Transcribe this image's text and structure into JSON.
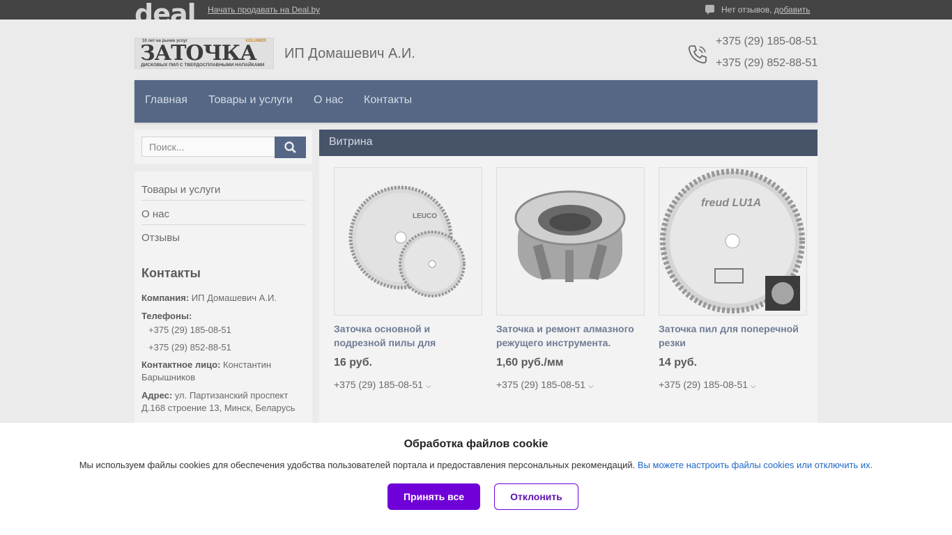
{
  "topbar": {
    "logo_text": "deal",
    "sell_link": "Начать продавать на Deal.by",
    "reviews_text": "Нет отзывов,",
    "reviews_add": "добавить"
  },
  "header": {
    "logo": {
      "top_small": "10 лет на рынке услуг",
      "brand": "VOLUMER",
      "word": "ЗАТОЧКА",
      "sub": "ДИСКОВЫХ ПИЛ С ТВЕРДОСПЛАВНЫМИ НАПАЙКАМИ"
    },
    "company": "ИП Домашевич А.И.",
    "phones": [
      "+375 (29) 185-08-51",
      "+375 (29) 852-88-51"
    ]
  },
  "nav": {
    "items": [
      "Главная",
      "Товары и услуги",
      "О нас",
      "Контакты"
    ]
  },
  "search": {
    "placeholder": "Поиск..."
  },
  "sidebar": {
    "menu": [
      "Товары и услуги",
      "О нас",
      "Отзывы"
    ],
    "contacts_title": "Контакты",
    "company_label": "Компания:",
    "company_value": "ИП Домашевич А.И.",
    "phones_label": "Телефоны:",
    "phones": [
      "+375 (29) 185-08-51",
      "+375 (29) 852-88-51"
    ],
    "person_label": "Контактное лицо:",
    "person_value": "Константин Барышников",
    "address_label": "Адрес:",
    "address_value": "ул. Партизанский проспект Д.168 строение 13, Минск, Беларусь"
  },
  "showcase": {
    "title": "Витрина",
    "products": [
      {
        "title": "Заточка основной и подрезной пилы для",
        "price": "16 руб.",
        "phone": "+375 (29) 185-08-51",
        "image_label": "LEUCO"
      },
      {
        "title": "Заточка и ремонт алмазного режущего инструмента.",
        "price": "1,60 руб./мм",
        "phone": "+375 (29) 185-08-51",
        "image_label": ""
      },
      {
        "title": "Заточка пил для поперечной резки",
        "price": "14 руб.",
        "phone": "+375 (29) 185-08-51",
        "image_label": "freud LU1A"
      }
    ]
  },
  "cookie": {
    "title": "Обработка файлов cookie",
    "text": "Мы используем файлы cookies для обеспечения удобства пользователей портала и предоставления персональных рекомендаций.",
    "link": "Вы можете настроить файлы cookies или отключить их.",
    "accept": "Принять все",
    "decline": "Отклонить"
  },
  "colors": {
    "nav": "#3e5275",
    "showcase_header": "#2d3c55",
    "accept": "#7000d8",
    "link": "#1f66c7"
  }
}
